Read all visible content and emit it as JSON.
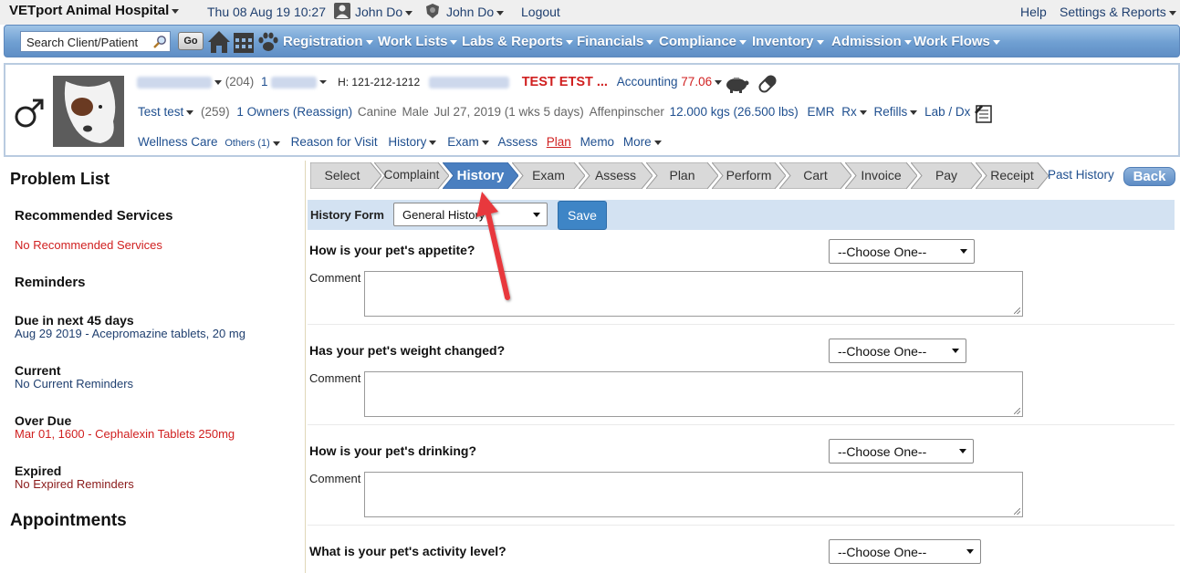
{
  "topbar": {
    "hospital": "VETport Animal Hospital",
    "datetime": "Thu 08 Aug 19 10:27",
    "user1": "John Do",
    "user2": "John Do",
    "logout": "Logout",
    "help": "Help",
    "settings": "Settings & Reports"
  },
  "nav": {
    "search_placeholder": "Search Client/Patient",
    "go": "Go",
    "menus": [
      "Registration",
      "Work Lists",
      "Labs & Reports",
      "Financials",
      "Compliance",
      "Inventory",
      "Admission",
      "Work Flows"
    ]
  },
  "patient": {
    "client_count": "(204)",
    "client_num": "1",
    "phone": "H: 121-212-1212",
    "flag": "TEST ETST ...",
    "accounting_label": "Accounting",
    "accounting_value": "77.06",
    "pet_name": "Test test",
    "pet_count": "(259)",
    "owners": "1 Owners (Reassign)",
    "species": "Canine",
    "sex": "Male",
    "dob": "Jul 27, 2019 (1 wks 5 days)",
    "breed": "Affenpinscher",
    "weight": "12.000 kgs (26.500 lbs)",
    "links": [
      "EMR",
      "Rx",
      "Refills",
      "Lab / Dx"
    ],
    "row3": {
      "wellness": "Wellness Care",
      "others": "Others (1)",
      "reason": "Reason for Visit",
      "history": "History",
      "exam": "Exam",
      "assess": "Assess",
      "plan": "Plan",
      "memo": "Memo",
      "more": "More"
    }
  },
  "left": {
    "problem_list": "Problem List",
    "recommended_title": "Recommended Services",
    "recommended_value": "No Recommended Services",
    "reminders": "Reminders",
    "due_title": "Due in next 45 days",
    "due_value": "Aug 29 2019 - Acepromazine tablets, 20 mg",
    "current_title": "Current",
    "current_value": "No Current Reminders",
    "overdue_title": "Over Due",
    "overdue_value": "Mar 01, 1600 - Cephalexin Tablets 250mg",
    "expired_title": "Expired",
    "expired_value": "No Expired Reminders",
    "appointments": "Appointments"
  },
  "workflow": {
    "steps": [
      "Select",
      "Complaint",
      "History",
      "Exam",
      "Assess",
      "Plan",
      "Perform",
      "Cart",
      "Invoice",
      "Pay",
      "Receipt"
    ],
    "active": "History",
    "past_history": "Past History",
    "back": "Back"
  },
  "form": {
    "label": "History Form",
    "selected": "General History",
    "save": "Save",
    "comment_label": "Comment",
    "choose": "--Choose One--",
    "questions": [
      "How is your pet's appetite?",
      "Has your pet's weight changed?",
      "How is your pet's drinking?",
      "What is your pet's activity level?"
    ]
  },
  "colors": {
    "nav_blue": "#6f9fd2",
    "active_step": "#4a7fc0",
    "alert_red": "#d02020",
    "link_blue": "#1f4f8f",
    "annotation_arrow": "#e8383d"
  }
}
